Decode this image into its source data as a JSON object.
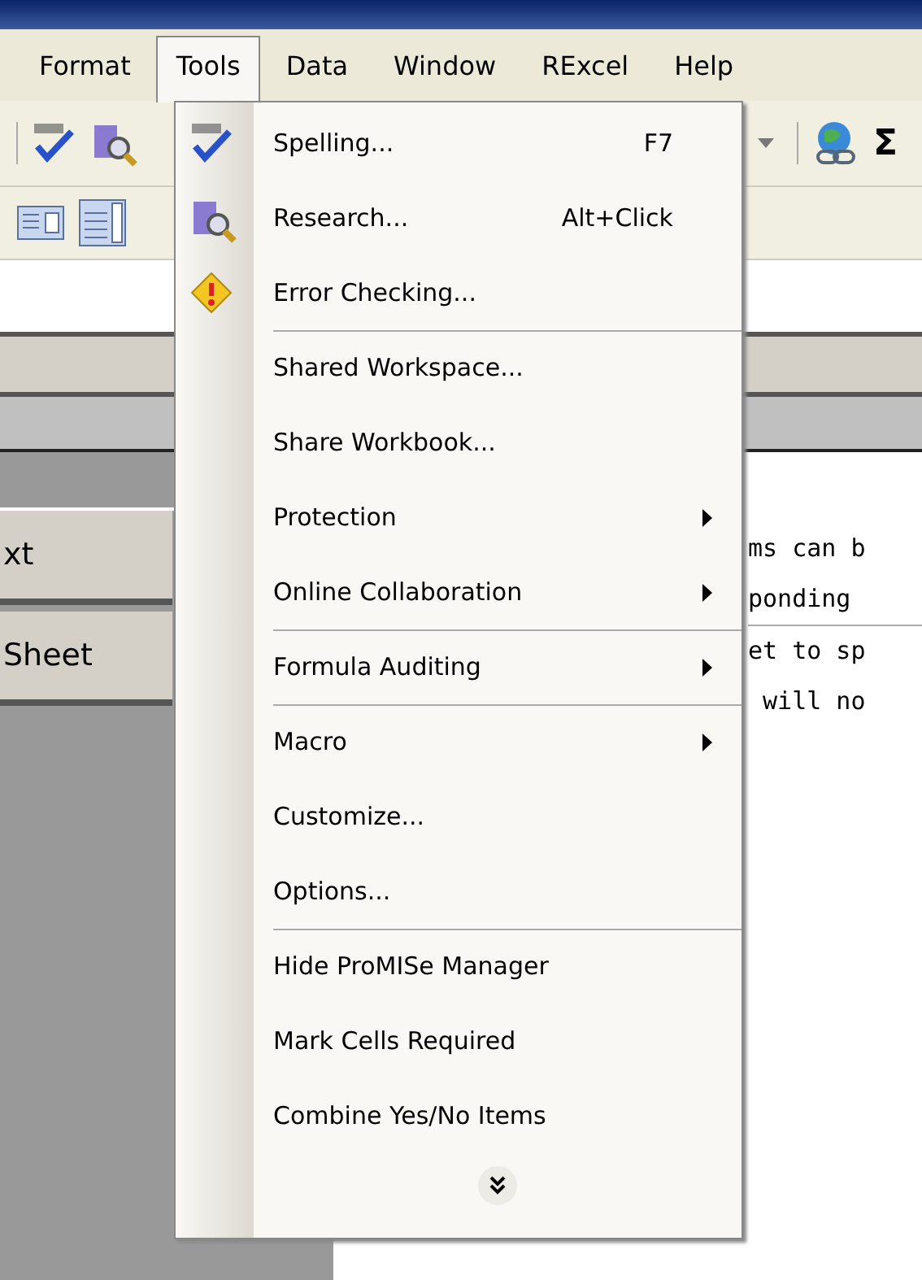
{
  "menu_bar": [
    {
      "label": "Format",
      "selected": false
    },
    {
      "label": "Tools",
      "selected": true
    },
    {
      "label": "Data",
      "selected": false
    },
    {
      "label": "Window",
      "selected": false
    },
    {
      "label": "RExcel",
      "selected": false
    },
    {
      "label": "Help",
      "selected": false
    }
  ],
  "toolbar": {
    "sum_glyph": "Σ"
  },
  "tools_menu": {
    "items": [
      {
        "label": "Spelling...",
        "shortcut": "F7",
        "submenu": false,
        "separator_before": false
      },
      {
        "label": "Research...",
        "shortcut": "Alt+Click",
        "submenu": false,
        "separator_before": false
      },
      {
        "label": "Error Checking...",
        "submenu": false,
        "separator_before": false
      },
      {
        "label": "Shared Workspace...",
        "submenu": false,
        "separator_before": true
      },
      {
        "label": "Share Workbook...",
        "submenu": false,
        "separator_before": false
      },
      {
        "label": "Protection",
        "submenu": true,
        "separator_before": false
      },
      {
        "label": "Online Collaboration",
        "submenu": true,
        "separator_before": false
      },
      {
        "label": "Formula Auditing",
        "submenu": true,
        "separator_before": true
      },
      {
        "label": "Macro",
        "submenu": true,
        "separator_before": true
      },
      {
        "label": "Customize...",
        "submenu": false,
        "separator_before": false
      },
      {
        "label": "Options...",
        "submenu": false,
        "separator_before": false
      },
      {
        "label": "Hide ProMISe Manager",
        "submenu": false,
        "separator_before": true
      },
      {
        "label": "Mark Cells Required",
        "submenu": false,
        "separator_before": false
      },
      {
        "label": "Combine Yes/No Items",
        "submenu": false,
        "separator_before": false
      }
    ]
  },
  "side_buttons": [
    "xt",
    "Sheet"
  ],
  "note_lines": [
    "ms can b",
    "ponding",
    "et to sp",
    " will no"
  ]
}
